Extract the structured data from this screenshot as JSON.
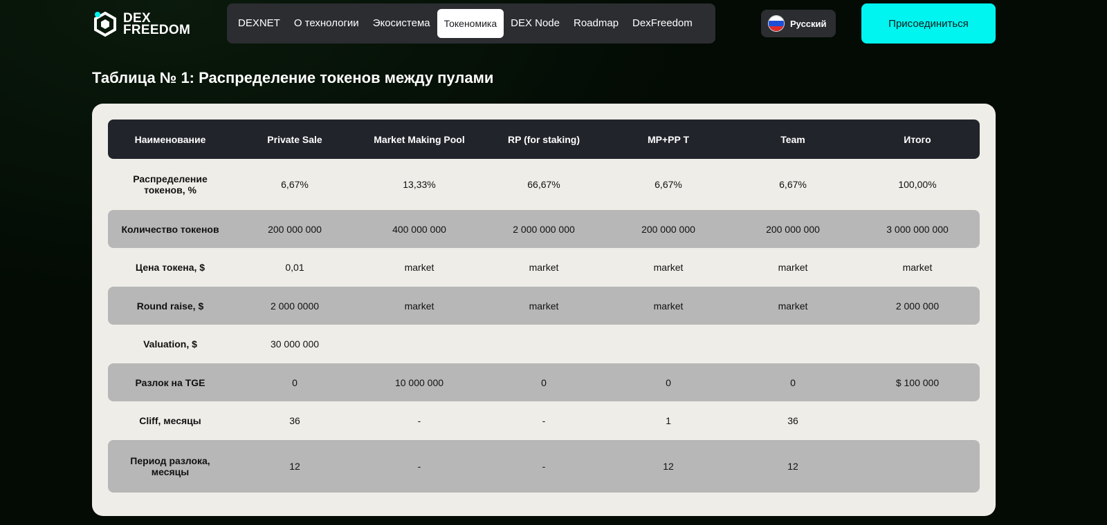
{
  "header": {
    "logo_line1": "DEX",
    "logo_line2": "FREEDOM",
    "nav": [
      "DEXNET",
      "О технологии",
      "Экосистема",
      "Токеномика",
      "DEX Node",
      "Roadmap",
      "DexFreedom"
    ],
    "active_nav": "Токеномика",
    "language": "Русский",
    "join_label": "Присоединиться"
  },
  "page": {
    "title": "Таблица № 1: Распределение токенов между пулами"
  },
  "table": {
    "columns": [
      "Наименование",
      "Private Sale",
      "Market Making Pool",
      "RP (for staking)",
      "MP+PP T",
      "Team",
      "Итого"
    ],
    "rows": [
      {
        "label": "Распределение токенов, %",
        "values": [
          "6,67%",
          "13,33%",
          "66,67%",
          "6,67%",
          "6,67%",
          "100,00%"
        ]
      },
      {
        "label": "Количество токенов",
        "values": [
          "200 000 000",
          "400 000 000",
          "2 000 000 000",
          "200 000 000",
          "200 000 000",
          "3 000 000 000"
        ]
      },
      {
        "label": "Цена токена, $",
        "values": [
          "0,01",
          "market",
          "market",
          "market",
          "market",
          "market"
        ]
      },
      {
        "label": "Round raise, $",
        "values": [
          "2 000 0000",
          "market",
          "market",
          "market",
          "market",
          "2 000 000"
        ]
      },
      {
        "label": "Valuation, $",
        "values": [
          "30 000 000",
          "",
          "",
          "",
          "",
          ""
        ]
      },
      {
        "label": "Разлок на TGE",
        "values": [
          "0",
          "10 000 000",
          "0",
          "0",
          "0",
          "$ 100 000"
        ]
      },
      {
        "label": "Cliff, месяцы",
        "values": [
          "36",
          "-",
          "-",
          "1",
          "36",
          ""
        ]
      },
      {
        "label": "Период разлока, месяцы",
        "values": [
          "12",
          "-",
          "-",
          "12",
          "12",
          ""
        ]
      }
    ]
  },
  "colors": {
    "background": "#030b04",
    "accent": "#00f5f0",
    "table_header": "#22242b",
    "row_shaded": "#b7b7b7",
    "panel": "#efede8"
  }
}
